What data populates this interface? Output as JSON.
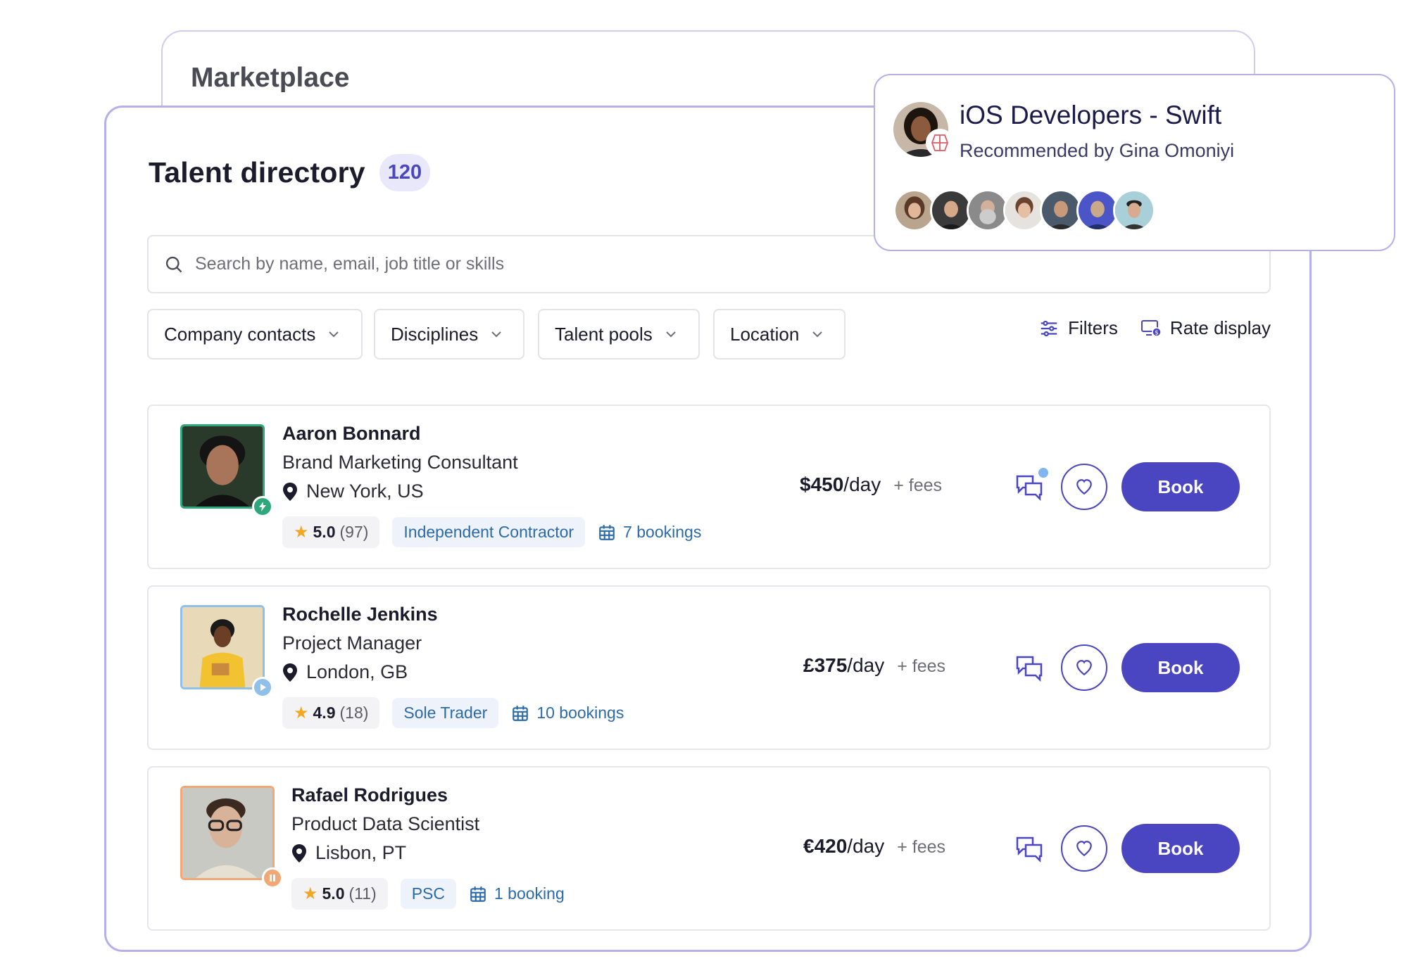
{
  "marketplace": {
    "title": "Marketplace"
  },
  "directory": {
    "title": "Talent directory",
    "count": "120",
    "search_placeholder": "Search by name, email, job title or skills",
    "filters": [
      "Company contacts",
      "Disciplines",
      "Talent pools",
      "Location"
    ],
    "tools": {
      "filters_label": "Filters",
      "rate_display_label": "Rate display"
    }
  },
  "talents": [
    {
      "name": "Aaron Bonnard",
      "role": "Brand Marketing Consultant",
      "location": "New York, US",
      "rating": "5.0",
      "reviews": "(97)",
      "type": "Independent Contractor",
      "bookings": "7 bookings",
      "rate": "$450",
      "per": "/day",
      "fees": "+ fees",
      "book_label": "Book",
      "status_icon": "lightning-icon",
      "border_color": "#2fa77c",
      "status_color": "#2fa77c",
      "skin": "#a8755a",
      "bg": "#2a3a2a",
      "has_message_dot": true
    },
    {
      "name": "Rochelle Jenkins",
      "role": "Project Manager",
      "location": "London, GB",
      "rating": "4.9",
      "reviews": "(18)",
      "type": "Sole Trader",
      "bookings": "10 bookings",
      "rate": "£375",
      "per": "/day",
      "fees": "+ fees",
      "book_label": "Book",
      "status_icon": "play-icon",
      "border_color": "#8fc0ea",
      "status_color": "#8fc0ea",
      "skin": "#6b3f26",
      "bg": "#e8d9b8",
      "has_message_dot": false
    },
    {
      "name": "Rafael Rodrigues",
      "role": "Product Data Scientist",
      "location": "Lisbon, PT",
      "rating": "5.0",
      "reviews": "(11)",
      "type": "PSC",
      "bookings": "1 booking",
      "rate": "€420",
      "per": "/day",
      "fees": "+ fees",
      "book_label": "Book",
      "status_icon": "pause-icon",
      "border_color": "#f2a774",
      "status_color": "#f2a774",
      "skin": "#d9b29a",
      "bg": "#c9c9c4",
      "has_message_dot": false
    }
  ],
  "recommendation": {
    "title": "iOS Developers - Swift",
    "subtitle": "Recommended by Gina Omoniyi"
  },
  "colors": {
    "accent": "#4a45c0",
    "card_border": "#b5b0ec",
    "link_blue": "#2c6aa8"
  }
}
